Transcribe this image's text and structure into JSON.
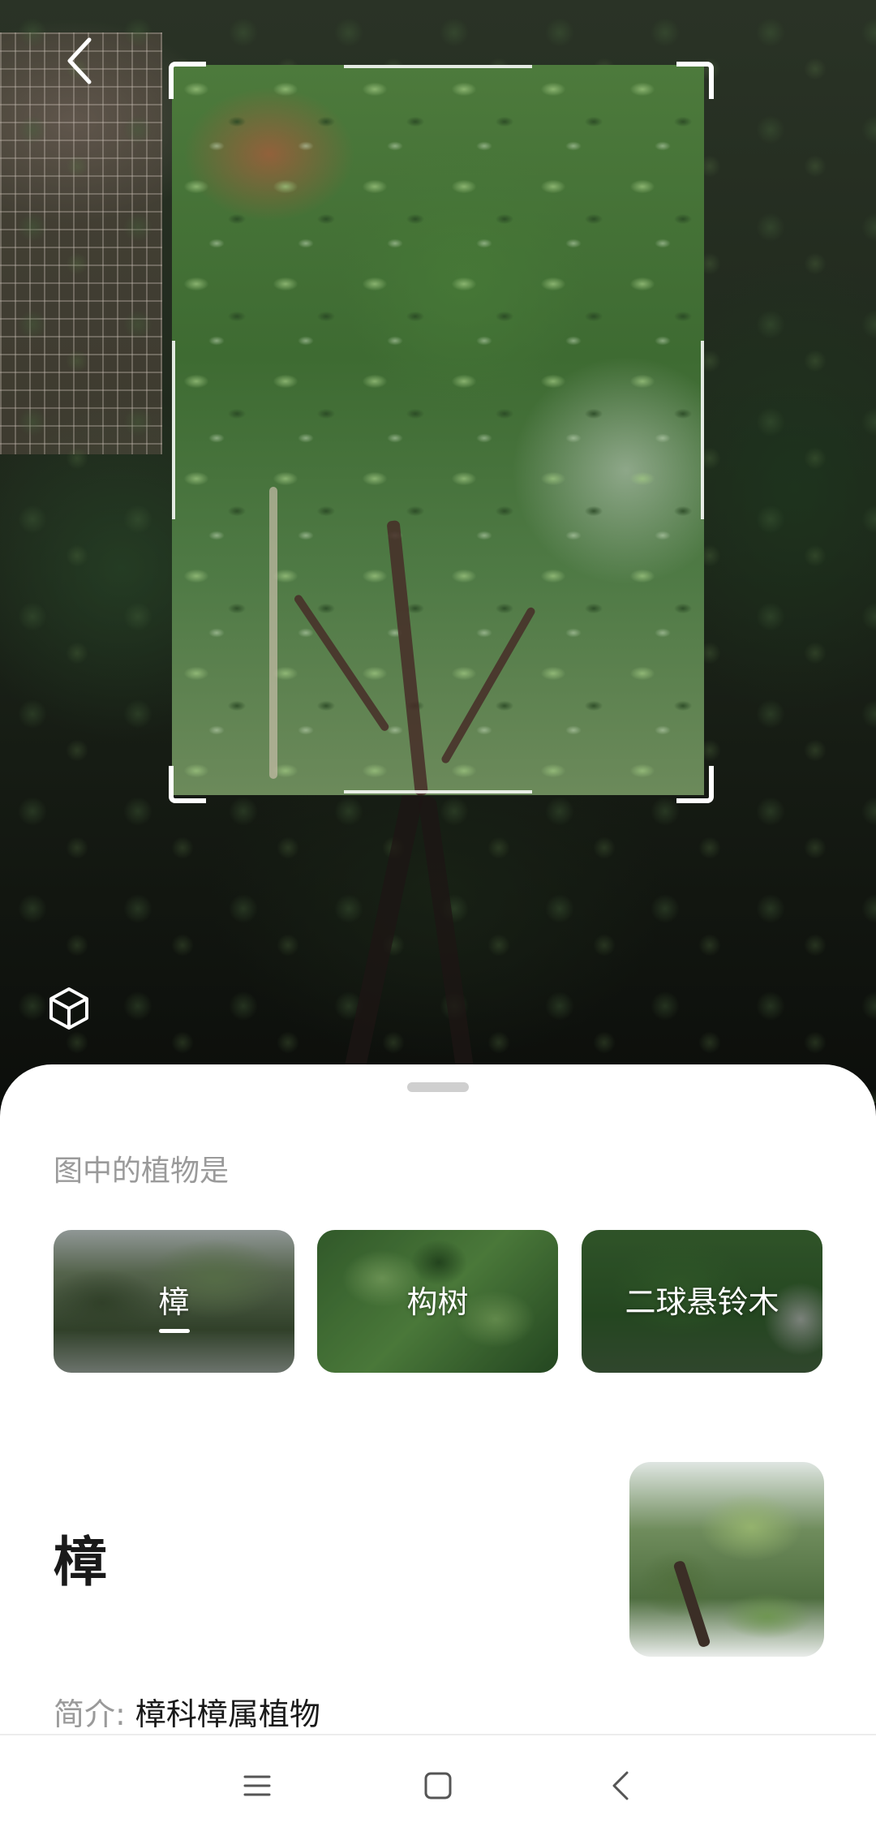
{
  "camera": {
    "back_icon": "chevron-left-icon",
    "ar_icon": "cube-icon"
  },
  "result": {
    "question": "图中的植物是",
    "candidates": [
      {
        "label": "樟",
        "selected": true
      },
      {
        "label": "构树",
        "selected": false
      },
      {
        "label": "二球悬铃木",
        "selected": false
      }
    ],
    "plant_name": "樟",
    "intro_label": "简介:",
    "intro_value": "樟科樟属植物"
  },
  "nav": {
    "menu_icon": "menu-icon",
    "home_icon": "square-home-icon",
    "back_icon": "back-triangle-icon"
  },
  "colors": {
    "muted_text": "#9a9a9a",
    "primary_text": "#1a1a1a",
    "sheet_bg": "#ffffff"
  }
}
